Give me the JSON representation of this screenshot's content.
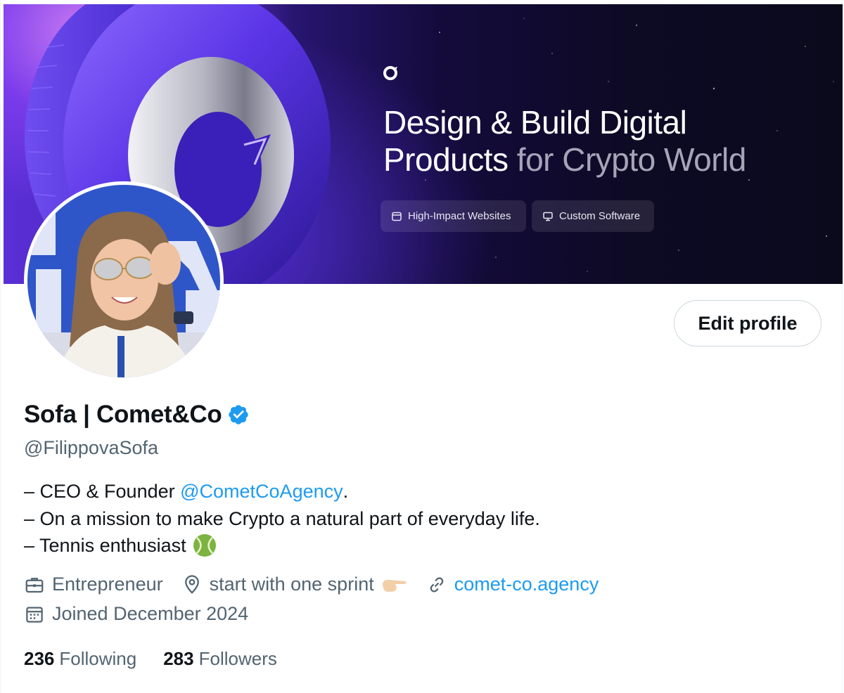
{
  "banner": {
    "headline_line1": "Design & Build Digital",
    "headline_line2_bright": "Products",
    "headline_line2_dim": " for Crypto World",
    "pills": [
      {
        "label": "High-Impact Websites",
        "icon": "browser-window-icon"
      },
      {
        "label": "Custom Software",
        "icon": "monitor-icon"
      }
    ],
    "logo_icon": "comet-logo-icon"
  },
  "profile": {
    "display_name": "Sofa | Comet&Co",
    "verified": true,
    "handle": "@FilippovaSofa",
    "edit_button": "Edit profile",
    "bio": {
      "line1_prefix": "– CEO & Founder ",
      "line1_mention": "@CometCoAgency",
      "line1_suffix": ".",
      "line2": "– On a mission to make Crypto a natural part of everyday life.",
      "line3": "– Tennis enthusiast"
    },
    "meta": {
      "profession": "Entrepreneur",
      "location": "start with one sprint",
      "website": "comet-co.agency",
      "joined": "Joined December 2024"
    },
    "stats": {
      "following_count": "236",
      "following_label": "Following",
      "followers_count": "283",
      "followers_label": "Followers"
    }
  },
  "colors": {
    "link": "#1d9bf0",
    "verified": "#1d9bf0",
    "secondary_text": "#536471",
    "primary_text": "#0f1419"
  }
}
